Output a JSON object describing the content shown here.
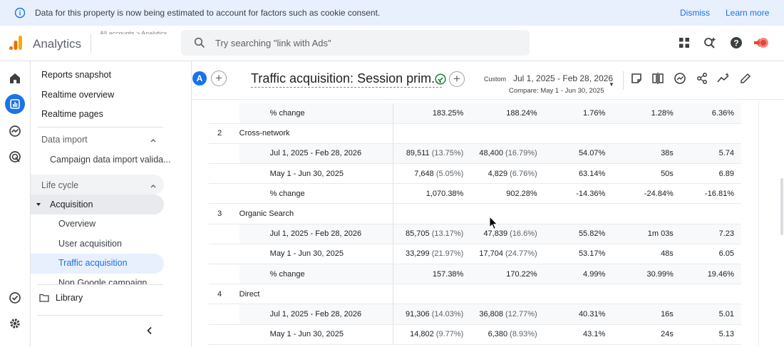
{
  "banner": {
    "message": "Data for this property is now being estimated to account for factors such as cookie consent.",
    "dismiss": "Dismiss",
    "learn_more": "Learn more"
  },
  "topbar": {
    "app_name": "Analytics",
    "account_crumb": "All accounts > Analytics",
    "search_placeholder": "Try searching \"link with Ads\""
  },
  "sidenav": {
    "items": [
      {
        "label": "Reports snapshot"
      },
      {
        "label": "Realtime overview"
      },
      {
        "label": "Realtime pages"
      }
    ],
    "data_import": "Data import",
    "data_import_child": "Campaign data import valida...",
    "life_cycle": "Life cycle",
    "acquisition": "Acquisition",
    "acq_children": [
      "Overview",
      "User acquisition",
      "Traffic acquisition",
      "Non Google campaign"
    ],
    "library": "Library"
  },
  "report": {
    "avatar_letter": "A",
    "title": "Traffic acquisition: Session prim...",
    "custom_label": "Custom",
    "date_range": "Jul 1, 2025 - Feb 28, 2026",
    "compare": "Compare: May 1 - Jun 30, 2025"
  },
  "table": {
    "rows": [
      {
        "kind": "sub",
        "label": "% change",
        "v": [
          "183.25%",
          "188.24%",
          "1.76%",
          "1.28%",
          "6.36%"
        ]
      },
      {
        "kind": "group",
        "idx": "2",
        "label": "Cross-network"
      },
      {
        "kind": "sub",
        "label": "Jul 1, 2025 - Feb 28, 2026",
        "v": [
          "89,511",
          "48,400",
          "54.07%",
          "38s",
          "5.74"
        ],
        "p": [
          "(13.75%)",
          "(16.79%)"
        ]
      },
      {
        "kind": "sub",
        "label": "May 1 - Jun 30, 2025",
        "v": [
          "7,648",
          "4,829",
          "63.14%",
          "50s",
          "6.89"
        ],
        "p": [
          "(5.05%)",
          "(6.76%)"
        ]
      },
      {
        "kind": "sub",
        "label": "% change",
        "v": [
          "1,070.38%",
          "902.28%",
          "-14.36%",
          "-24.84%",
          "-16.81%"
        ]
      },
      {
        "kind": "group",
        "idx": "3",
        "label": "Organic Search"
      },
      {
        "kind": "sub",
        "label": "Jul 1, 2025 - Feb 28, 2026",
        "v": [
          "85,705",
          "47,839",
          "55.82%",
          "1m 03s",
          "7.23"
        ],
        "p": [
          "(13.17%)",
          "(16.6%)"
        ]
      },
      {
        "kind": "sub",
        "label": "May 1 - Jun 30, 2025",
        "v": [
          "33,299",
          "17,704",
          "53.17%",
          "48s",
          "6.05"
        ],
        "p": [
          "(21.97%)",
          "(24.77%)"
        ]
      },
      {
        "kind": "sub",
        "label": "% change",
        "v": [
          "157.38%",
          "170.22%",
          "4.99%",
          "30.99%",
          "19.46%"
        ]
      },
      {
        "kind": "group",
        "idx": "4",
        "label": "Direct"
      },
      {
        "kind": "sub",
        "label": "Jul 1, 2025 - Feb 28, 2026",
        "v": [
          "91,306",
          "36,808",
          "40.31%",
          "16s",
          "5.01"
        ],
        "p": [
          "(14.03%)",
          "(12.77%)"
        ]
      },
      {
        "kind": "sub",
        "label": "May 1 - Jun 30, 2025",
        "v": [
          "14,802",
          "6,380",
          "43.1%",
          "24s",
          "5.13"
        ],
        "p": [
          "(9.77%)",
          "(8.93%)"
        ]
      }
    ]
  }
}
